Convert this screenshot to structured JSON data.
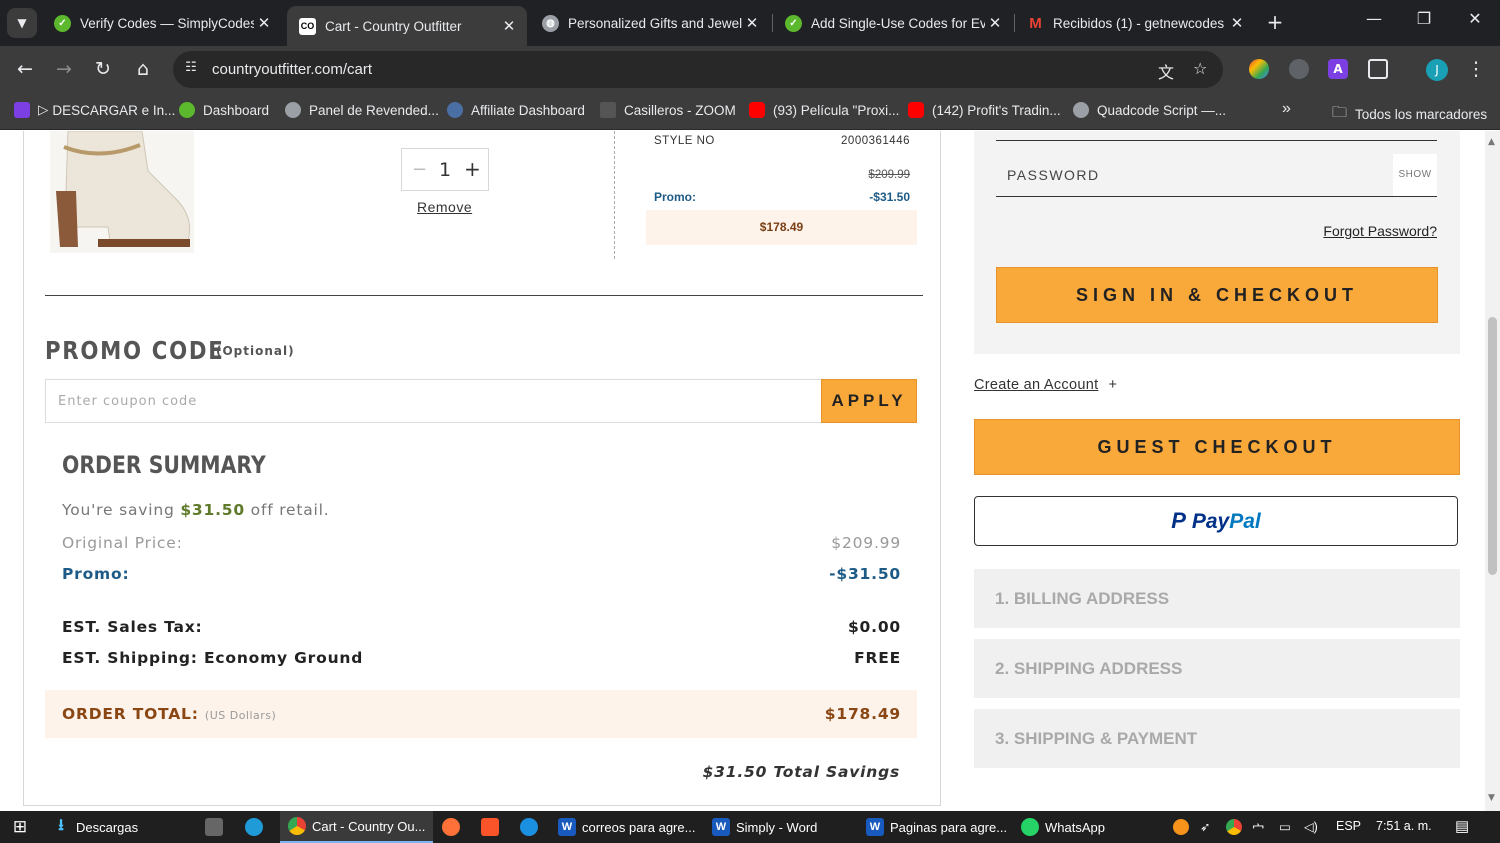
{
  "browser": {
    "tabs": [
      {
        "title": "Verify Codes — SimplyCodes",
        "active": false
      },
      {
        "title": "Cart - Country Outfitter",
        "active": true
      },
      {
        "title": "Personalized Gifts and Jewelry",
        "active": false
      },
      {
        "title": "Add Single-Use Codes for Every",
        "active": false
      },
      {
        "title": "Recibidos (1) - getnewcodes",
        "active": false
      }
    ],
    "favicon_co": "CO",
    "url": "countryoutfitter.com/cart",
    "profile_initial": "J",
    "bookmarks": [
      "DESCARGAR e In...",
      "Dashboard",
      "Panel de Revended...",
      "Affiliate Dashboard",
      "Casilleros - ZOOM",
      "(93) Película \"Proxi...",
      "(142) Profit's Tradin...",
      "Quadcode Script —..."
    ],
    "bookmark_prefix": "▷",
    "all_bookmarks": "Todos los marcadores",
    "more_bookmarks": "»"
  },
  "item": {
    "quantity": "1",
    "qty_minus": "−",
    "qty_plus": "+",
    "remove_label": "Remove",
    "style_label": "STYLE NO",
    "style_no": "2000361446",
    "original_price": "$209.99",
    "promo_label": "Promo:",
    "promo_value": "-$31.50",
    "item_total": "$178.49"
  },
  "promo": {
    "title": "PROMO CODE",
    "optional": "(Optional)",
    "placeholder": "Enter coupon code",
    "apply_label": "APPLY"
  },
  "summary": {
    "title": "ORDER SUMMARY",
    "saving_prefix": "You're saving ",
    "saving_amount": "$31.50",
    "saving_suffix": " off retail.",
    "original_label": "Original Price:",
    "original_value": "$209.99",
    "promo_label": "Promo:",
    "promo_value": "-$31.50",
    "tax_label": "EST. Sales Tax:",
    "tax_value": "$0.00",
    "shipping_label": "EST. Shipping: Economy Ground",
    "shipping_value": "FREE",
    "total_label": "ORDER TOTAL:",
    "total_currency": "(US Dollars)",
    "total_value": "$178.49",
    "total_savings": "$31.50 Total Savings"
  },
  "checkout": {
    "password_label": "PASSWORD",
    "show_label": "SHOW",
    "forgot_label": "Forgot Password?",
    "signin_label": "SIGN IN & CHECKOUT",
    "create_account_label": "Create an Account",
    "create_account_plus": "+",
    "guest_label": "GUEST CHECKOUT",
    "paypal_pay": "Pay",
    "paypal_pal": "Pal",
    "steps": [
      "1. BILLING ADDRESS",
      "2. SHIPPING ADDRESS",
      "3. SHIPPING & PAYMENT"
    ]
  },
  "taskbar": {
    "items": [
      "Descargas",
      "Cart - Country Ou...",
      "correos para agre...",
      "Simply - Word",
      "Paginas para agre...",
      "WhatsApp"
    ],
    "language": "ESP",
    "time": "7:51 a. m."
  },
  "colors": {
    "accent_orange": "#f9a83a",
    "promo_blue": "#1d5b86",
    "total_brown": "#8a4613",
    "saving_green": "#5e7a2a"
  }
}
